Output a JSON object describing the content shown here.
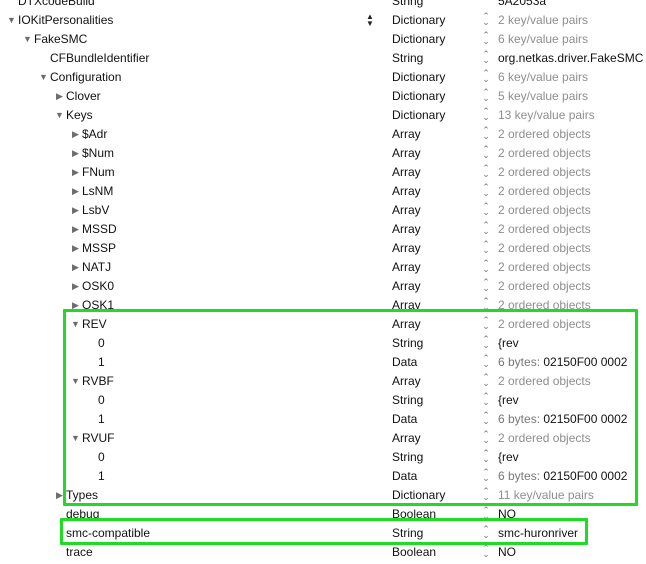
{
  "rows": [
    {
      "key": "DTXcodeBuild",
      "indent": 0,
      "disclosure": "none",
      "type": "String",
      "value": "5A2053a",
      "value_style": "dark",
      "stepper": false
    },
    {
      "key": "IOKitPersonalities",
      "indent": 0,
      "disclosure": "expanded",
      "type": "Dictionary",
      "value": "2 key/value pairs",
      "value_style": "muted",
      "stepper": true
    },
    {
      "key": "FakeSMC",
      "indent": 1,
      "disclosure": "expanded",
      "type": "Dictionary",
      "value": "6 key/value pairs",
      "value_style": "muted"
    },
    {
      "key": "CFBundleIdentifier",
      "indent": 2,
      "disclosure": "none",
      "type": "String",
      "value": "org.netkas.driver.FakeSMC",
      "value_style": "dark"
    },
    {
      "key": "Configuration",
      "indent": 2,
      "disclosure": "expanded",
      "type": "Dictionary",
      "value": "6 key/value pairs",
      "value_style": "muted"
    },
    {
      "key": "Clover",
      "indent": 3,
      "disclosure": "collapsed",
      "type": "Dictionary",
      "value": "5 key/value pairs",
      "value_style": "muted"
    },
    {
      "key": "Keys",
      "indent": 3,
      "disclosure": "expanded",
      "type": "Dictionary",
      "value": "13 key/value pairs",
      "value_style": "muted"
    },
    {
      "key": "$Adr",
      "indent": 4,
      "disclosure": "collapsed",
      "type": "Array",
      "value": "2 ordered objects",
      "value_style": "muted"
    },
    {
      "key": "$Num",
      "indent": 4,
      "disclosure": "collapsed",
      "type": "Array",
      "value": "2 ordered objects",
      "value_style": "muted"
    },
    {
      "key": "FNum",
      "indent": 4,
      "disclosure": "collapsed",
      "type": "Array",
      "value": "2 ordered objects",
      "value_style": "muted"
    },
    {
      "key": "LsNM",
      "indent": 4,
      "disclosure": "collapsed",
      "type": "Array",
      "value": "2 ordered objects",
      "value_style": "muted"
    },
    {
      "key": "LsbV",
      "indent": 4,
      "disclosure": "collapsed",
      "type": "Array",
      "value": "2 ordered objects",
      "value_style": "muted"
    },
    {
      "key": "MSSD",
      "indent": 4,
      "disclosure": "collapsed",
      "type": "Array",
      "value": "2 ordered objects",
      "value_style": "muted"
    },
    {
      "key": "MSSP",
      "indent": 4,
      "disclosure": "collapsed",
      "type": "Array",
      "value": "2 ordered objects",
      "value_style": "muted"
    },
    {
      "key": "NATJ",
      "indent": 4,
      "disclosure": "collapsed",
      "type": "Array",
      "value": "2 ordered objects",
      "value_style": "muted"
    },
    {
      "key": "OSK0",
      "indent": 4,
      "disclosure": "collapsed",
      "type": "Array",
      "value": "2 ordered objects",
      "value_style": "muted"
    },
    {
      "key": "OSK1",
      "indent": 4,
      "disclosure": "collapsed",
      "type": "Array",
      "value": "2 ordered objects",
      "value_style": "muted"
    },
    {
      "key": "REV",
      "indent": 4,
      "disclosure": "expanded",
      "type": "Array",
      "value": "2 ordered objects",
      "value_style": "muted"
    },
    {
      "key": "0",
      "indent": 5,
      "disclosure": "none",
      "type": "String",
      "value": "{rev",
      "value_style": "dark"
    },
    {
      "key": "1",
      "indent": 5,
      "disclosure": "none",
      "type": "Data",
      "value_prefix": "6 bytes: ",
      "value": "02150F00 0002",
      "value_style": "data"
    },
    {
      "key": "RVBF",
      "indent": 4,
      "disclosure": "expanded",
      "type": "Array",
      "value": "2 ordered objects",
      "value_style": "muted"
    },
    {
      "key": "0",
      "indent": 5,
      "disclosure": "none",
      "type": "String",
      "value": "{rev",
      "value_style": "dark"
    },
    {
      "key": "1",
      "indent": 5,
      "disclosure": "none",
      "type": "Data",
      "value_prefix": "6 bytes: ",
      "value": "02150F00 0002",
      "value_style": "data"
    },
    {
      "key": "RVUF",
      "indent": 4,
      "disclosure": "expanded",
      "type": "Array",
      "value": "2 ordered objects",
      "value_style": "muted"
    },
    {
      "key": "0",
      "indent": 5,
      "disclosure": "none",
      "type": "String",
      "value": "{rev",
      "value_style": "dark"
    },
    {
      "key": "1",
      "indent": 5,
      "disclosure": "none",
      "type": "Data",
      "value_prefix": "6 bytes: ",
      "value": "02150F00 0002",
      "value_style": "data"
    },
    {
      "key": "Types",
      "indent": 3,
      "disclosure": "collapsed",
      "type": "Dictionary",
      "value": "11 key/value pairs",
      "value_style": "muted"
    },
    {
      "key": "debug",
      "indent": 3,
      "disclosure": "none",
      "type": "Boolean",
      "value": "NO",
      "value_style": "dark"
    },
    {
      "key": "smc-compatible",
      "indent": 3,
      "disclosure": "none",
      "type": "String",
      "value": "smc-huronriver",
      "value_style": "dark"
    },
    {
      "key": "trace",
      "indent": 3,
      "disclosure": "none",
      "type": "Boolean",
      "value": "NO",
      "value_style": "dark"
    }
  ],
  "colors": {
    "highlight": "#1edc23",
    "muted_value": "#8e8e8e"
  }
}
